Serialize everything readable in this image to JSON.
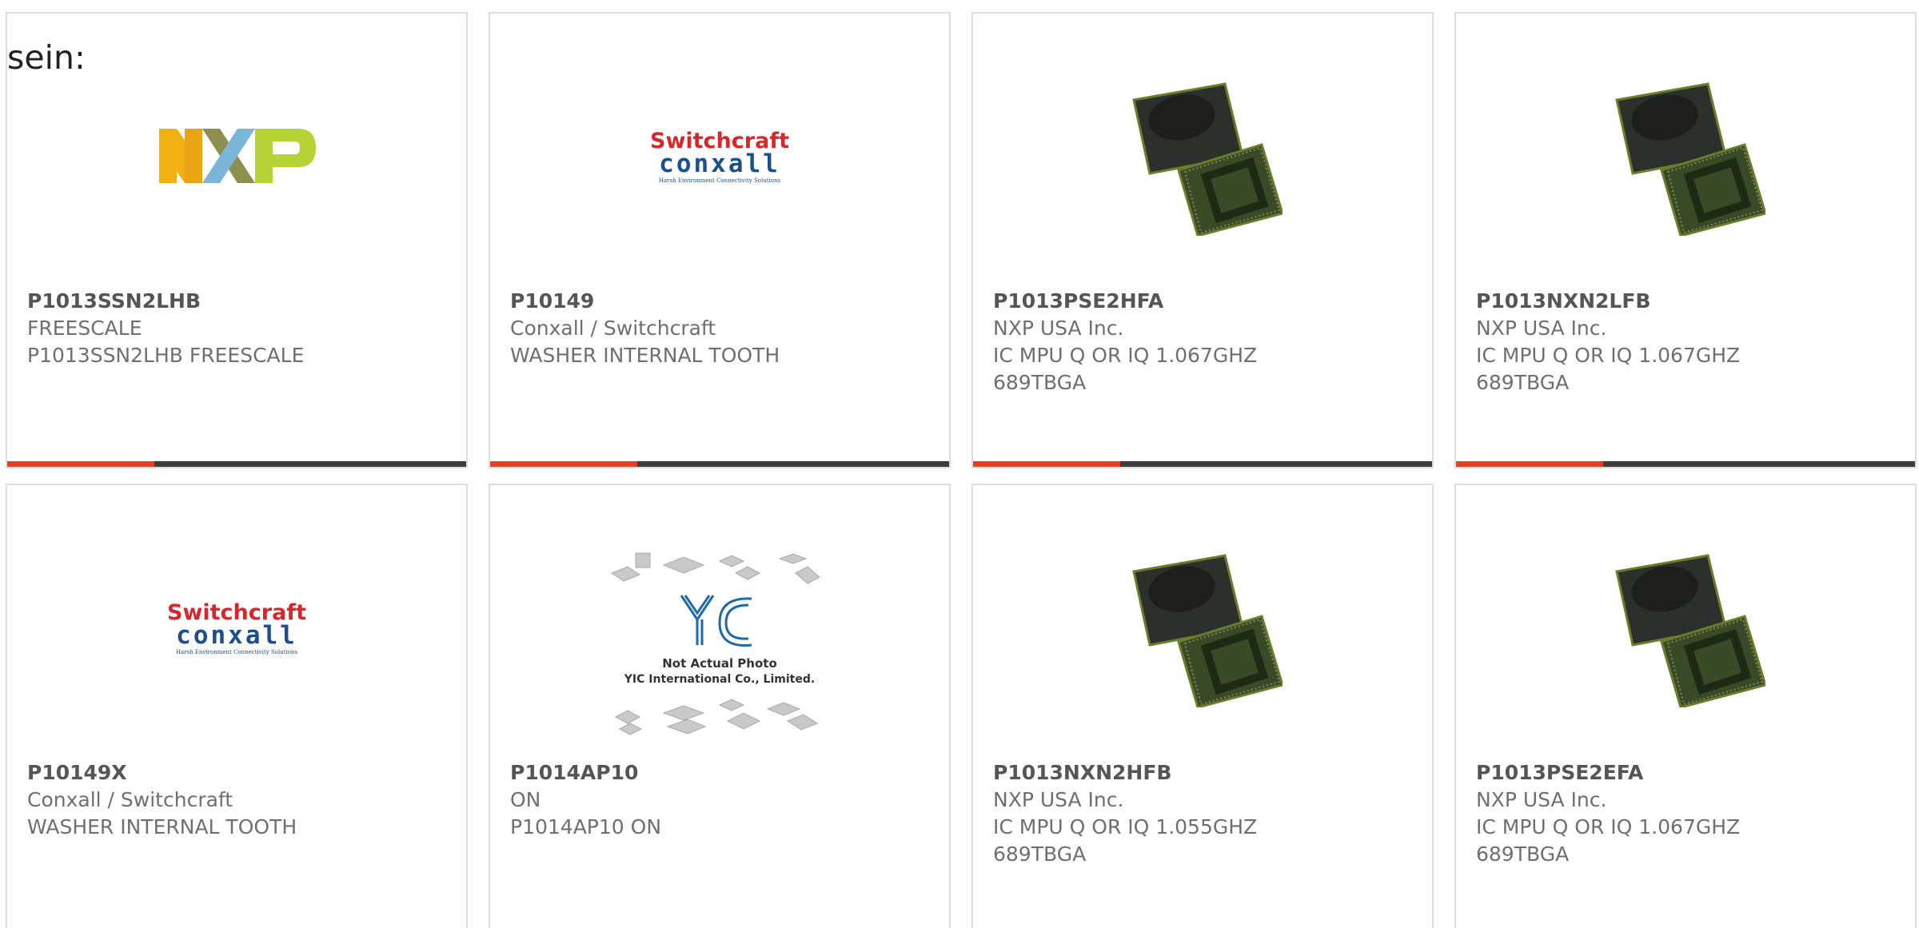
{
  "lead_text": "sein:",
  "colors": {
    "accent": "#e8401c",
    "bar_dark": "#3d3d3d",
    "card_border": "#dddddd",
    "text_muted": "#6f6f6f",
    "nxp_yellow": "#f2b113",
    "nxp_blue": "#7bb6d9",
    "nxp_green": "#b5d335",
    "switchcraft_red": "#d9262b",
    "conxall_blue": "#1d4f8c"
  },
  "products": [
    {
      "part": "P1013SSN2LHB",
      "maker": "FREESCALE",
      "desc": "P1013SSN2LHB FREESCALE",
      "desc2": "",
      "image": "nxp-logo",
      "logo_letters": "NXP"
    },
    {
      "part": "P10149",
      "maker": "Conxall / Switchcraft",
      "desc": "WASHER INTERNAL TOOTH",
      "desc2": "",
      "image": "switchcraft-conxall-logo",
      "logo_top": "Switchcraft",
      "logo_bottom": "conxall",
      "logo_tagline": "Harsh Environment Connectivity Solutions"
    },
    {
      "part": "P1013PSE2HFA",
      "maker": "NXP USA Inc.",
      "desc": "IC MPU Q OR IQ 1.067GHZ",
      "desc2": "689TBGA",
      "image": "bga-chip-photo"
    },
    {
      "part": "P1013NXN2LFB",
      "maker": "NXP USA Inc.",
      "desc": "IC MPU Q OR IQ 1.067GHZ",
      "desc2": "689TBGA",
      "image": "bga-chip-photo"
    },
    {
      "part": "P10149X",
      "maker": "Conxall / Switchcraft",
      "desc": "WASHER INTERNAL TOOTH",
      "desc2": "",
      "image": "switchcraft-conxall-logo",
      "logo_top": "Switchcraft",
      "logo_bottom": "conxall",
      "logo_tagline": "Harsh Environment Connectivity Solutions"
    },
    {
      "part": "P1014AP10",
      "maker": "ON",
      "desc": "P1014AP10 ON",
      "desc2": "",
      "image": "yic-placeholder",
      "placeholder_line1": "Not Actual Photo",
      "placeholder_line2": "YIC International Co., Limited.",
      "placeholder_mark": "YIC"
    },
    {
      "part": "P1013NXN2HFB",
      "maker": "NXP USA Inc.",
      "desc": "IC MPU Q OR IQ 1.055GHZ",
      "desc2": "689TBGA",
      "image": "bga-chip-photo"
    },
    {
      "part": "P1013PSE2EFA",
      "maker": "NXP USA Inc.",
      "desc": "IC MPU Q OR IQ 1.067GHZ",
      "desc2": "689TBGA",
      "image": "bga-chip-photo"
    }
  ]
}
